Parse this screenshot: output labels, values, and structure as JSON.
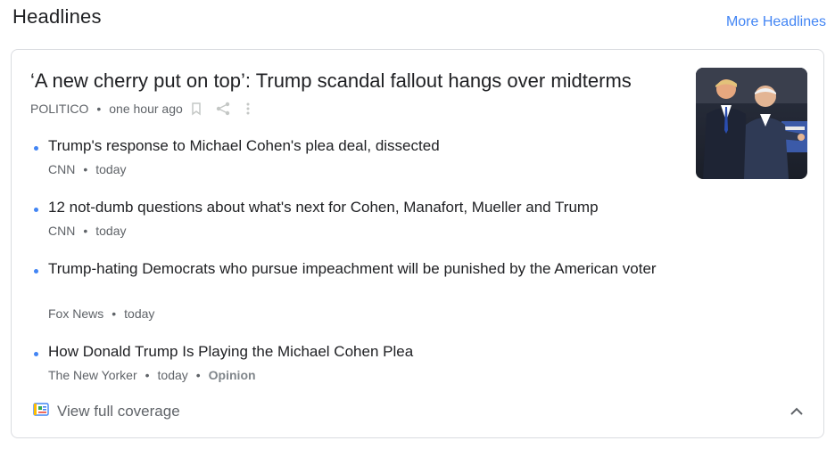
{
  "section": {
    "title": "Headlines",
    "more_link": "More Headlines"
  },
  "main_story": {
    "headline": "‘A new cherry put on top’: Trump scandal fallout hangs over midterms",
    "source": "POLITICO",
    "time": "one hour ago",
    "icons": [
      "bookmark-icon",
      "share-icon",
      "more-vert-icon"
    ]
  },
  "related": [
    {
      "title": "Trump's response to Michael Cohen's plea deal, dissected",
      "source": "CNN",
      "time": "today"
    },
    {
      "title": "12 not-dumb questions about what's next for Cohen, Manafort, Mueller and Trump",
      "source": "CNN",
      "time": "today"
    },
    {
      "title": "Trump-hating Democrats who pursue impeachment will be punished by the American voter",
      "source": "Fox News",
      "time": "today"
    },
    {
      "title": "How Donald Trump Is Playing the Michael Cohen Plea",
      "source": "The New Yorker",
      "time": "today",
      "tag": "Opinion"
    }
  ],
  "footer": {
    "label": "View full coverage",
    "icon": "full-coverage-icon",
    "collapse_icon": "chevron-up-icon"
  },
  "colors": {
    "accent": "#4285f4",
    "text": "#202124",
    "secondary": "#5f6368",
    "border": "#dadce0"
  }
}
